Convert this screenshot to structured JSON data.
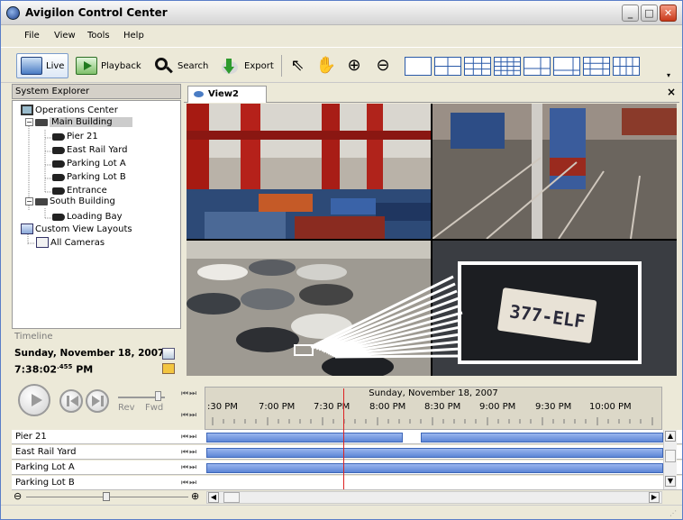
{
  "window": {
    "title": "Avigilon Control Center"
  },
  "menu": [
    "File",
    "View",
    "Tools",
    "Help"
  ],
  "toolbar": {
    "live": "Live",
    "playback": "Playback",
    "search": "Search",
    "export": "Export"
  },
  "explorer": {
    "title": "System Explorer",
    "items": [
      "Operations Center",
      "Main Building",
      "Pier 21",
      "East Rail Yard",
      "Parking Lot A",
      "Parking Lot B",
      "Entrance",
      "South Building",
      "Loading Bay",
      "Custom View Layouts",
      "All Cameras"
    ]
  },
  "timeline": {
    "label": "Timeline",
    "date": "Sunday, November 18, 2007",
    "time_main": "7:38:02",
    "time_ms": ".455",
    "time_ampm": " PM",
    "rev": "Rev",
    "fwd": "Fwd"
  },
  "view_tab": {
    "label": "View2",
    "close": "×"
  },
  "timeline_chart": {
    "date_header": "Sunday, November 18, 2007",
    "ticks": [
      ":30 PM",
      "7:00 PM",
      "7:30 PM",
      "8:00 PM",
      "8:30 PM",
      "9:00 PM",
      "9:30 PM",
      "10:00 PM"
    ],
    "tracks": [
      "Pier 21",
      "East Rail Yard",
      "Parking Lot A",
      "Parking Lot B"
    ]
  },
  "plate": "377-ELF",
  "colors": {
    "accent": "#3d66b8",
    "playhead": "#dd2222"
  }
}
